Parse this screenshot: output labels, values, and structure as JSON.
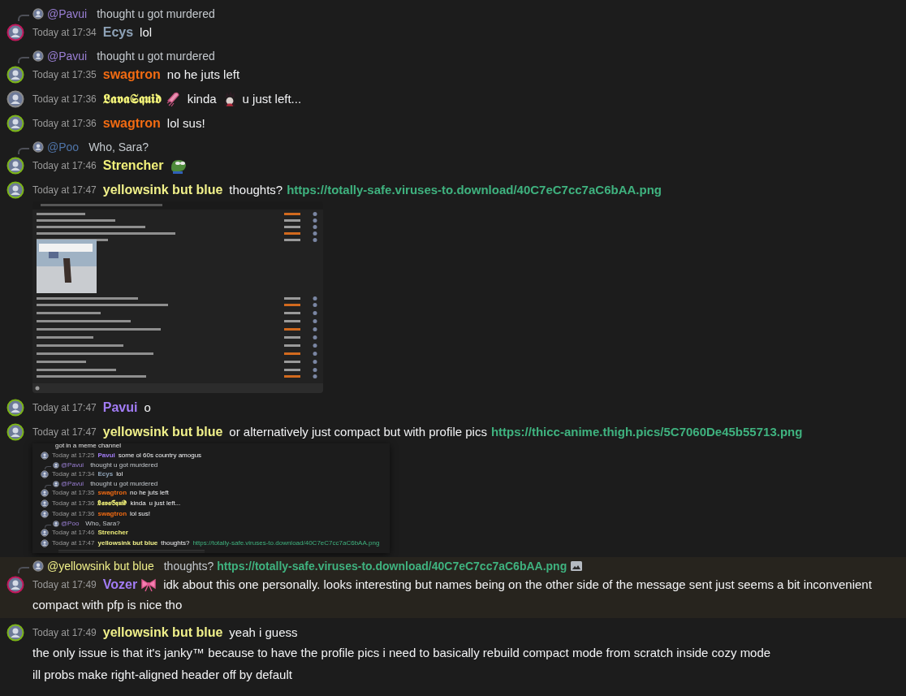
{
  "messages": [
    {
      "reply": {
        "author": {
          "name": "@Pavui",
          "color": "#9a7fd4"
        },
        "parts": [
          {
            "kind": "text",
            "text": "thought u got murdered"
          }
        ]
      },
      "avatar": {
        "color": "#c2185b"
      },
      "time": "Today at 17:34",
      "author": {
        "name": "Ecys",
        "color": "#8ea3b8"
      },
      "lines": [
        [
          {
            "kind": "text",
            "text": "lol"
          }
        ]
      ]
    },
    {
      "reply": {
        "author": {
          "name": "@Pavui",
          "color": "#9a7fd4"
        },
        "parts": [
          {
            "kind": "text",
            "text": "thought u got murdered"
          }
        ]
      },
      "avatar": {
        "color": "#7cb518"
      },
      "time": "Today at 17:35",
      "author": {
        "name": "swagtron",
        "color": "#f26b12"
      },
      "lines": [
        [
          {
            "kind": "text",
            "text": "no he juts left"
          }
        ]
      ]
    },
    {
      "avatar": {
        "color": "#8a8a8a"
      },
      "time": "Today at 17:36",
      "author": {
        "name": "𝕷𝖆𝖛𝖆𝕾𝖖𝖚𝖎𝖉",
        "color": "#f5f57a"
      },
      "author_icons": [
        {
          "kind": "squid"
        }
      ],
      "lines": [
        [
          {
            "kind": "text",
            "text": "kinda"
          },
          {
            "kind": "figure"
          },
          {
            "kind": "text",
            "text": "u just left..."
          }
        ]
      ]
    },
    {
      "avatar": {
        "color": "#7cb518"
      },
      "time": "Today at 17:36",
      "author": {
        "name": "swagtron",
        "color": "#f26b12"
      },
      "lines": [
        [
          {
            "kind": "text",
            "text": "lol sus!"
          }
        ]
      ]
    },
    {
      "reply": {
        "author": {
          "name": "@Poo",
          "color": "#4f74a8"
        },
        "parts": [
          {
            "kind": "text",
            "text": "Who, Sara?"
          }
        ]
      },
      "avatar": {
        "color": "#7cb518"
      },
      "time": "Today at 17:46",
      "author": {
        "name": "Strencher",
        "color": "#f1f07a"
      },
      "lines": [
        [
          {
            "kind": "frog"
          }
        ]
      ]
    },
    {
      "avatar": {
        "color": "#7cb518"
      },
      "time": "Today at 17:47",
      "author": {
        "name": "yellowsink but blue",
        "color": "#f0f08a"
      },
      "lines": [
        [
          {
            "kind": "text",
            "text": "thoughts?"
          },
          {
            "kind": "link",
            "text": "https://totally-safe.viruses-to.download/40C7eC7cc7aC6bAA.png"
          }
        ]
      ],
      "attachment": {
        "kind": "screenshot"
      }
    },
    {
      "avatar": {
        "color": "#7cb518"
      },
      "time": "Today at 17:47",
      "author": {
        "name": "Pavui",
        "color": "#a27cf5"
      },
      "lines": [
        [
          {
            "kind": "text",
            "text": "o"
          }
        ]
      ]
    },
    {
      "avatar": {
        "color": "#7cb518"
      },
      "time": "Today at 17:47",
      "author": {
        "name": "yellowsink but blue",
        "color": "#f0f08a"
      },
      "lines": [
        [
          {
            "kind": "text",
            "text": "or alternatively just compact but with profile pics"
          },
          {
            "kind": "link",
            "text": "https://thicc-anime.thigh.pics/5C7060De45b55713.png"
          }
        ]
      ],
      "attachment": {
        "kind": "chat_preview",
        "messages": [
          {
            "kind": "text_only",
            "text": "got in a meme channel"
          },
          {
            "kind": "message",
            "time": "Today at 17:25",
            "author": {
              "name": "Pavui",
              "color": "#a27cf5"
            },
            "text": "some ol 60s country amogus"
          },
          {
            "kind": "message",
            "reply_author": "@Pavui",
            "reply_text": "thought u got murdered",
            "time": "Today at 17:34",
            "author": {
              "name": "Ecys",
              "color": "#8ea3b8"
            },
            "text": "lol"
          },
          {
            "kind": "message",
            "reply_author": "@Pavui",
            "reply_text": "thought u got murdered",
            "time": "Today at 17:35",
            "author": {
              "name": "swagtron",
              "color": "#f26b12"
            },
            "text": "no he juts left"
          },
          {
            "kind": "message",
            "time": "Today at 17:36",
            "author": {
              "name": "𝕷𝖆𝖛𝖆𝕾𝖖𝖚𝖎𝖉",
              "color": "#f5f57a"
            },
            "text": "kinda",
            "text2": "u just left..."
          },
          {
            "kind": "message",
            "time": "Today at 17:36",
            "author": {
              "name": "swagtron",
              "color": "#f26b12"
            },
            "text": "lol sus!"
          },
          {
            "kind": "message",
            "reply_author": "@Poo",
            "reply_text": "Who, Sara?",
            "time": "Today at 17:46",
            "author": {
              "name": "Strencher",
              "color": "#f1f07a"
            }
          },
          {
            "kind": "message",
            "time": "Today at 17:47",
            "author": {
              "name": "yellowsink but blue",
              "color": "#f0f08a"
            },
            "text": "thoughts?",
            "link": "https://totally-safe.viruses-to.download/40C7eC7cc7aC6bAA.png"
          }
        ]
      }
    },
    {
      "reply": {
        "author": {
          "name": "@yellowsink but blue",
          "color": "#f0f08a"
        },
        "parts": [
          {
            "kind": "text",
            "text": "thoughts?"
          },
          {
            "kind": "link",
            "text": "https://totally-safe.viruses-to.download/40C7eC7cc7aC6bAA.png"
          },
          {
            "kind": "image"
          }
        ]
      },
      "avatar": {
        "color": "#c2185b"
      },
      "time": "Today at 17:49",
      "author": {
        "name": "Vozer",
        "color": "#a27cf5"
      },
      "author_icons": [
        {
          "kind": "ribbon"
        }
      ],
      "highlighted": true,
      "lines": [
        [
          {
            "kind": "text",
            "text": "idk about this one personally. looks interesting but names being on the other side of the message sent just seems a bit inconvenient"
          }
        ],
        [
          {
            "kind": "text",
            "text": "compact with pfp is nice tho"
          }
        ]
      ]
    },
    {
      "avatar": {
        "color": "#7cb518"
      },
      "time": "Today at 17:49",
      "author": {
        "name": "yellowsink but blue",
        "color": "#f0f08a"
      },
      "lines": [
        [
          {
            "kind": "text",
            "text": "yeah i guess"
          }
        ],
        [
          {
            "kind": "text",
            "text": "the only issue is that it's janky™ because to have the profile pics i need to basically rebuild compact mode from scratch inside cozy mode"
          }
        ],
        [
          {
            "kind": "text",
            "text": "ill probs make right-aligned header off by default"
          }
        ]
      ]
    }
  ]
}
